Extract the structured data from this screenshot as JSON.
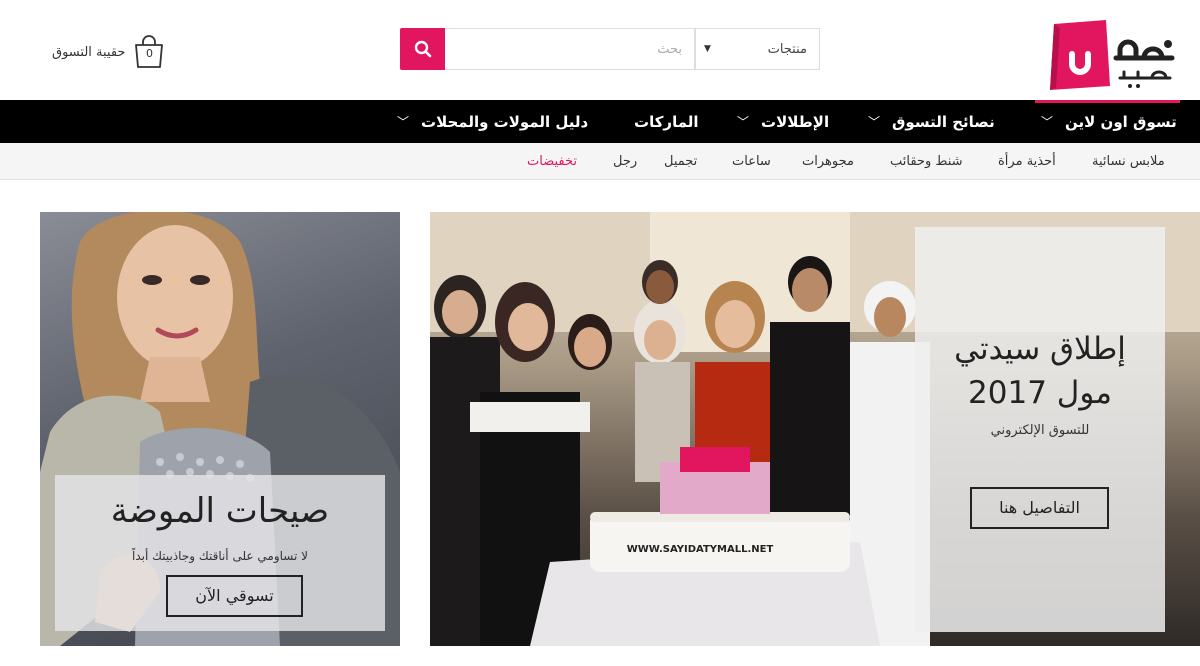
{
  "header": {
    "cart": {
      "label": "حقيبة التسوق",
      "count": "0",
      "icon": "shopping-bag-icon"
    },
    "search": {
      "category": "منتجات",
      "placeholder": "بحث",
      "icon": "search-icon"
    },
    "logo": {
      "line1": "مول",
      "line2": "سيّدتي",
      "brand_color": "#e2165e"
    }
  },
  "main_nav": {
    "items": [
      {
        "label": "تسوق اون لاين",
        "has_dropdown": true
      },
      {
        "label": "نصائح التسوق",
        "has_dropdown": true
      },
      {
        "label": "الإطلالات",
        "has_dropdown": true
      },
      {
        "label": "الماركات",
        "has_dropdown": false
      },
      {
        "label": "دليل المولات والمحلات",
        "has_dropdown": true
      }
    ]
  },
  "sub_nav": {
    "items": [
      {
        "label": "ملابس نسائية"
      },
      {
        "label": "أحذية مرأة"
      },
      {
        "label": "شنط وحقائب"
      },
      {
        "label": "مجوهرات"
      },
      {
        "label": "ساعات"
      },
      {
        "label": "تجميل"
      },
      {
        "label": "رجل"
      },
      {
        "label": "تخفيضات",
        "highlight": true
      }
    ]
  },
  "banners": {
    "left": {
      "title": "صيحات الموضة",
      "subtitle": "لا تساومي على أناقتك وجاذبيتك أبداً",
      "button": "تسوقي الآن"
    },
    "right": {
      "title_line1": "إطلاق سيدتي",
      "title_line2": "مول 2017",
      "subtitle": "للتسوق الإلكتروني",
      "button": "التفاصيل هنا",
      "cake_text": "WWW.SAYIDATYMALL.NET"
    }
  },
  "colors": {
    "accent": "#e2165e",
    "nav_bg": "#000000",
    "subnav_bg": "#f5f5f5"
  }
}
